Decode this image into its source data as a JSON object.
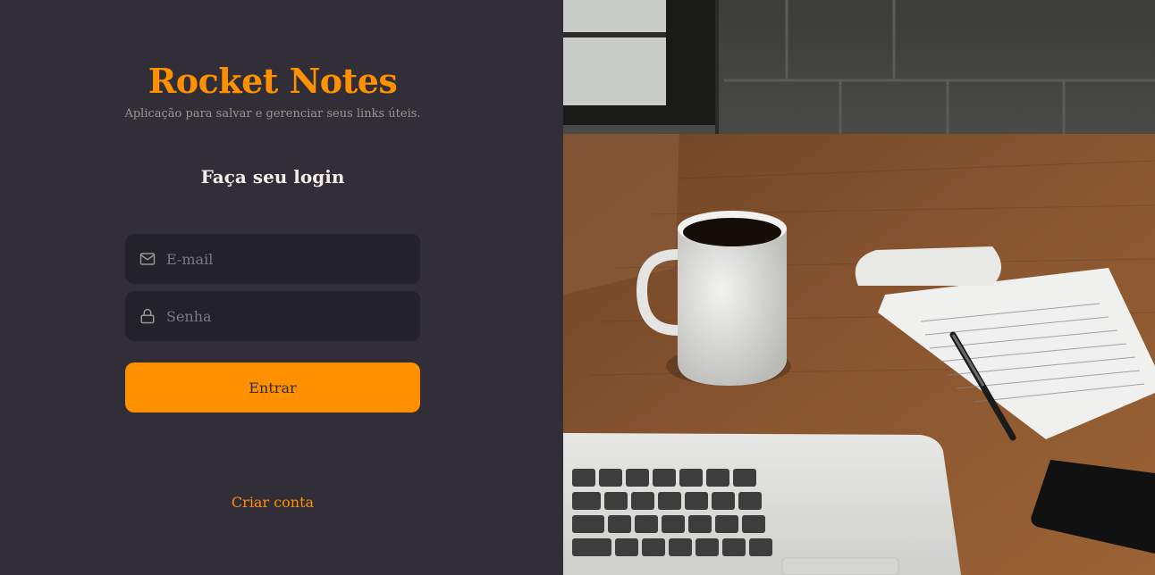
{
  "brand": {
    "title": "Rocket Notes",
    "subtitle": "Aplicação para salvar e gerenciar seus links úteis."
  },
  "form": {
    "heading": "Faça seu login",
    "email": {
      "placeholder": "E-mail",
      "icon": "mail-icon"
    },
    "password": {
      "placeholder": "Senha",
      "icon": "lock-icon"
    },
    "submit_label": "Entrar"
  },
  "footer": {
    "create_account_label": "Criar conta"
  },
  "colors": {
    "background": "#312e38",
    "accent": "#ff9000",
    "input_bg": "#232129",
    "text_light": "#f4ede8",
    "text_muted": "#999591"
  },
  "background_image": {
    "icon": "desk-photo"
  }
}
